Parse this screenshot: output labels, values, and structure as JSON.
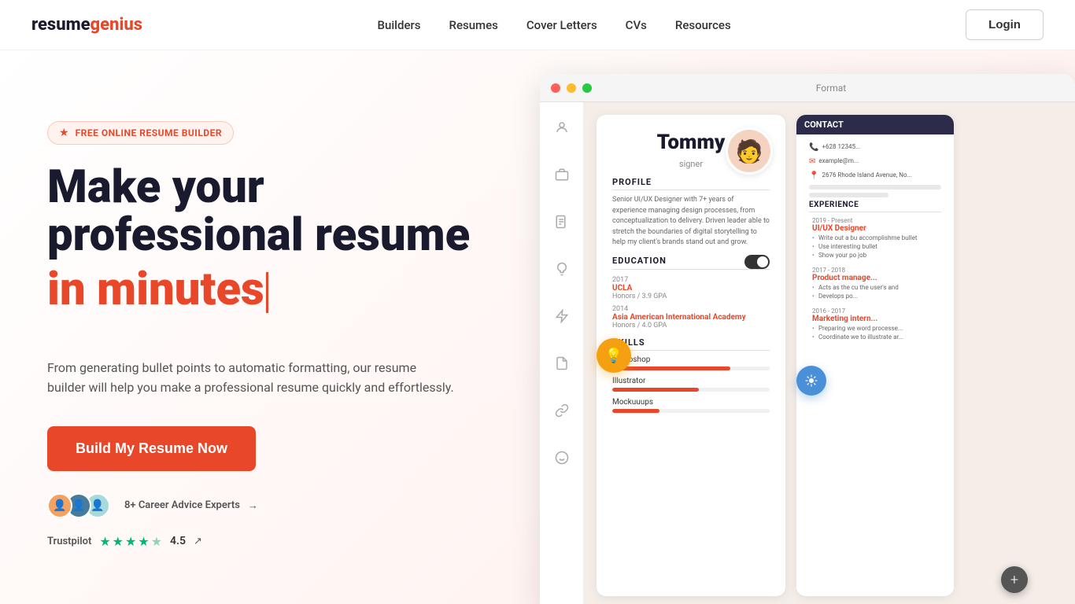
{
  "header": {
    "logo_resume": "resume",
    "logo_genius": "genius",
    "nav": {
      "items": [
        {
          "label": "Builders",
          "id": "builders"
        },
        {
          "label": "Resumes",
          "id": "resumes"
        },
        {
          "label": "Cover Letters",
          "id": "cover-letters"
        },
        {
          "label": "CVs",
          "id": "cvs"
        },
        {
          "label": "Resources",
          "id": "resources"
        }
      ]
    },
    "login_label": "Login"
  },
  "hero": {
    "badge": "FREE ONLINE RESUME BUILDER",
    "title_line1": "Make your",
    "title_line2": "professional resume",
    "title_accent": "in minutes",
    "description": "From generating bullet points to automatic formatting, our resume builder will help you make a professional resume quickly and effortlessly.",
    "cta_label": "Build My Resume Now",
    "social_proof": {
      "count": "8+",
      "label": "Career Advice Experts",
      "arrow": "→"
    },
    "trustpilot": {
      "label": "Trustpilot",
      "rating": "4.5",
      "arrow": "↗"
    }
  },
  "mockup": {
    "window_title": "Format",
    "resume": {
      "name": "Tommy",
      "subtitle": "signer",
      "profile_title": "PROFILE",
      "profile_text": "Senior UI/UX Designer with 7+ years of experience managing design processes, from conceptualization to delivery. Driven leader able to stretch the boundaries of digital storytelling to help my client's brands stand out and grow.",
      "education_title": "EDUCATION",
      "edu_items": [
        {
          "year": "2017",
          "school": "UCLA",
          "honors": "Honors / 3.9 GPA"
        },
        {
          "year": "2014",
          "school": "Asia American International Academy",
          "honors": "Honors / 4.0 GPA"
        }
      ],
      "skills_title": "SKILLS",
      "skills": [
        {
          "name": "Photoshop",
          "percent": 75
        },
        {
          "name": "Illustrator",
          "percent": 55
        },
        {
          "name": "Mockuuups",
          "percent": 30
        }
      ],
      "contact_title": "CONTACT",
      "contact_items": [
        {
          "icon": "📞",
          "text": "+628 12345..."
        },
        {
          "icon": "✉",
          "text": "example@m..."
        },
        {
          "icon": "📍",
          "text": "2676 Rhode Island Avenue, No..."
        }
      ],
      "experience_title": "EXPERIENCE",
      "exp_items": [
        {
          "years": "2019 - Present",
          "role": "UI/UX Designer",
          "bullets": [
            "Write out a bu accomplishme bullet",
            "Use interesting bullet",
            "Show your po job"
          ]
        },
        {
          "years": "2017 - 2018",
          "role": "Product manage...",
          "bullets": [
            "Acts as the cu the user's and",
            "Develops po..."
          ]
        },
        {
          "years": "2016 - 2017",
          "role": "Marketing intern...",
          "bullets": [
            "Preparing we word processe...",
            "Coordinate we to illustrate ar..."
          ]
        }
      ]
    },
    "sidebar_icons": [
      "person",
      "briefcase",
      "file",
      "lightbulb",
      "bolt",
      "document",
      "link",
      "emoji"
    ]
  }
}
